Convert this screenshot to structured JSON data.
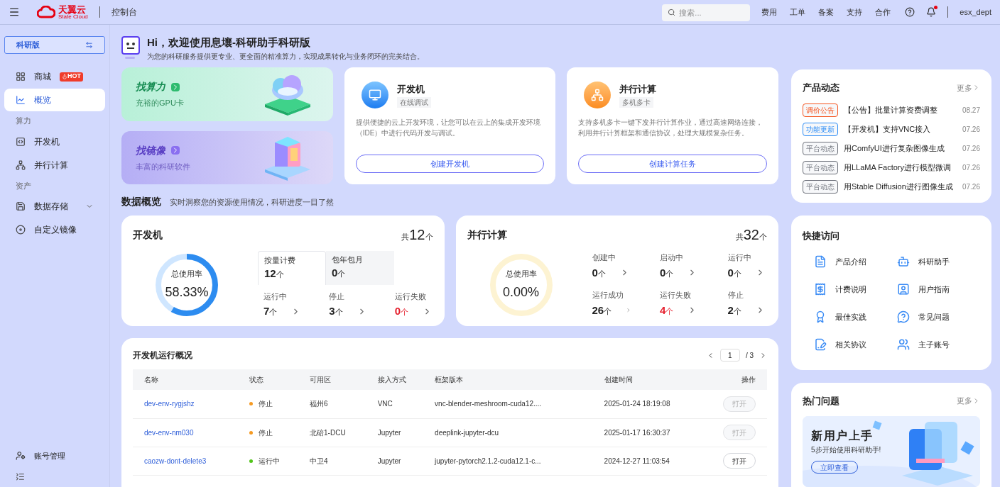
{
  "header": {
    "logo_text": "天翼云",
    "logo_subtitle": "State Cloud",
    "console_label": "控制台",
    "search_placeholder": "搜索...",
    "nav": [
      "费用",
      "工单",
      "备案",
      "支持",
      "合作"
    ],
    "has_notification": true,
    "user": "esx_dept"
  },
  "sidebar": {
    "edition": "科研版",
    "items": [
      {
        "kind": "item",
        "label": "商城",
        "badge": "HOT",
        "selected": false
      },
      {
        "kind": "item",
        "label": "概览",
        "selected": true
      },
      {
        "kind": "section",
        "label": "算力"
      },
      {
        "kind": "item",
        "label": "开发机",
        "selected": false
      },
      {
        "kind": "item",
        "label": "并行计算",
        "selected": false
      },
      {
        "kind": "section",
        "label": "资产"
      },
      {
        "kind": "item",
        "label": "数据存储",
        "selected": false,
        "expandable": true
      },
      {
        "kind": "item",
        "label": "自定义镜像",
        "selected": false
      }
    ],
    "footer": "账号管理"
  },
  "welcome": {
    "title": "Hi，欢迎使用息壤-科研助手科研版",
    "subtitle": "为您的科研服务提供更专业、更全面的精准算力，实现成果转化与业务闭环的完美结合。"
  },
  "promo_cards": [
    {
      "kind": "compute",
      "title": "找算力",
      "subtitle": "充裕的GPU卡"
    },
    {
      "title": "找镜像",
      "subtitle": "丰富的科研软件"
    }
  ],
  "product_cards": [
    {
      "kind": "dev",
      "title": "开发机",
      "tag": "在线调试",
      "description": "提供便捷的云上开发环境，让您可以在云上的集成开发环境（IDE）中进行代码开发与调试。",
      "button": "创建开发机"
    },
    {
      "kind": "parallel",
      "title": "并行计算",
      "tag": "多机多卡",
      "description": "支持多机多卡一键下发并行计算作业，通过高速网络连接，利用并行计算框架和通信协议，处理大规模复杂任务。",
      "button": "创建计算任务"
    }
  ],
  "overview": {
    "title": "数据概览",
    "subtitle": "实时洞察您的资源使用情况，科研进度一目了然"
  },
  "stat_cards": [
    {
      "kind": "dev",
      "title": "开发机",
      "total_prefix": "共",
      "total": "12",
      "total_unit": "个",
      "gauge_label": "总使用率",
      "gauge_value": "58.33%",
      "level": 0.5833,
      "tabs": [
        {
          "label": "按量计费",
          "value": "12",
          "unit": "个",
          "selected": true
        },
        {
          "label": "包年包月",
          "value": "0",
          "unit": "个",
          "selected": false
        }
      ],
      "stats": [
        {
          "label": "运行中",
          "value": "7",
          "unit": "个",
          "alert": false
        },
        {
          "label": "停止",
          "value": "3",
          "unit": "个",
          "alert": false
        },
        {
          "label": "运行失败",
          "value": "0",
          "unit": "个",
          "alert": true
        }
      ]
    },
    {
      "kind": "parallel",
      "title": "并行计算",
      "total_prefix": "共",
      "total": "32",
      "total_unit": "个",
      "gauge_label": "总使用率",
      "gauge_value": "0.00%",
      "level": 0,
      "stats": [
        {
          "label": "创建中",
          "value": "0",
          "unit": "个",
          "alert": false
        },
        {
          "label": "启动中",
          "value": "0",
          "unit": "个",
          "alert": false
        },
        {
          "label": "运行中",
          "value": "0",
          "unit": "个",
          "alert": false
        },
        {
          "label": "运行成功",
          "value": "26",
          "unit": "个",
          "alert": false
        },
        {
          "label": "运行失败",
          "value": "4",
          "unit": "个",
          "alert": true
        },
        {
          "label": "停止",
          "value": "2",
          "unit": "个",
          "alert": false
        }
      ]
    }
  ],
  "table": {
    "title": "开发机运行概况",
    "page": "1",
    "pages": "/ 3",
    "columns": [
      "名称",
      "状态",
      "可用区",
      "接入方式",
      "框架版本",
      "创建时间",
      "操作"
    ],
    "rows": [
      {
        "name": "dev-env-rygjshz",
        "status": "停止",
        "color": "#f59a23",
        "zone": "福州6",
        "access": "VNC",
        "framework": "vnc-blender-meshroom-cuda12....",
        "created": "2025-01-24 18:19:08",
        "action": "打开",
        "disabled": true
      },
      {
        "name": "dev-env-nm030",
        "status": "停止",
        "color": "#f59a23",
        "zone": "北碚1-DCU",
        "access": "Jupyter",
        "framework": "deeplink-jupyter-dcu",
        "created": "2025-01-17 16:30:37",
        "action": "打开",
        "disabled": true
      },
      {
        "name": "caozw-dont-delete3",
        "status": "运行中",
        "color": "#52c41a",
        "zone": "中卫4",
        "access": "Jupyter",
        "framework": "jupyter-pytorch2.1.2-cuda12.1-c...",
        "created": "2024-12-27 11:03:54",
        "action": "打开",
        "disabled": false
      }
    ]
  },
  "news": {
    "title": "产品动态",
    "more": "更多",
    "items": [
      {
        "tag": "调价公告",
        "color": "#f5541f",
        "text": "【公告】批量计算资费调整",
        "date": "08.27"
      },
      {
        "tag": "功能更新",
        "color": "#2b8cf6",
        "text": "【开发机】支持VNC接入",
        "date": "07.26"
      },
      {
        "tag": "平台动态",
        "color": "#6b6f78",
        "text": "用ComfyUI进行复杂图像生成",
        "date": "07.26"
      },
      {
        "tag": "平台动态",
        "color": "#6b6f78",
        "text": "用LLaMA Factory进行模型微调",
        "date": "07.26"
      },
      {
        "tag": "平台动态",
        "color": "#6b6f78",
        "text": "用Stable Diffusion进行图像生成",
        "date": "07.26"
      }
    ]
  },
  "quick_access": {
    "title": "快捷访问",
    "items": [
      {
        "label": "产品介绍"
      },
      {
        "label": "科研助手"
      },
      {
        "label": "计费说明"
      },
      {
        "label": "用户指南"
      },
      {
        "label": "最佳实践"
      },
      {
        "label": "常见问题"
      },
      {
        "label": "相关协议"
      },
      {
        "label": "主子账号"
      }
    ]
  },
  "hot": {
    "title": "热门问题",
    "more": "更多",
    "banner": {
      "title": "新用户上手",
      "subtitle": "5步开始使用科研助手!",
      "button": "立即查看"
    }
  }
}
